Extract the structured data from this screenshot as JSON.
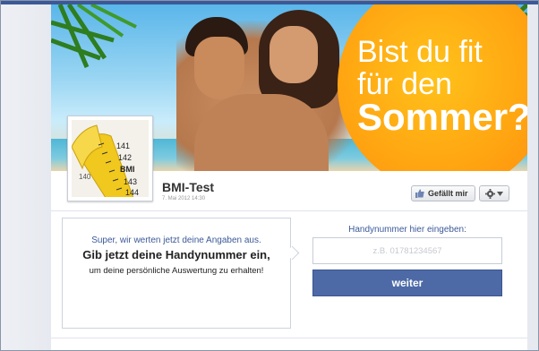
{
  "banner": {
    "headline_line1": "Bist du fit",
    "headline_line2": "für den",
    "headline_line3": "Sommer?"
  },
  "profile": {
    "image_icon": "measuring-tape-icon",
    "tape_numbers": [
      "141",
      "142",
      "BMI",
      "143",
      "144",
      "140"
    ],
    "title": "BMI-Test",
    "date": "7. Mai 2012 14:30"
  },
  "actions": {
    "like_label": "Gefällt mir",
    "like_icon": "thumbs-up-icon",
    "gear_icon": "gear-icon",
    "menu_icon": "caret-down-icon"
  },
  "message": {
    "line1": "Super, wir werten jetzt deine Angaben aus.",
    "line2": "Gib jetzt deine Handynummer ein,",
    "line3": "um deine persönliche Auswertung zu erhalten!"
  },
  "form": {
    "label": "Handynummer hier eingeben:",
    "placeholder": "z.B. 01781234567",
    "value": "",
    "submit_label": "weiter"
  },
  "colors": {
    "brand_blue": "#3b5998",
    "button_blue": "#4d6aa7",
    "sun_orange": "#ffa311"
  }
}
